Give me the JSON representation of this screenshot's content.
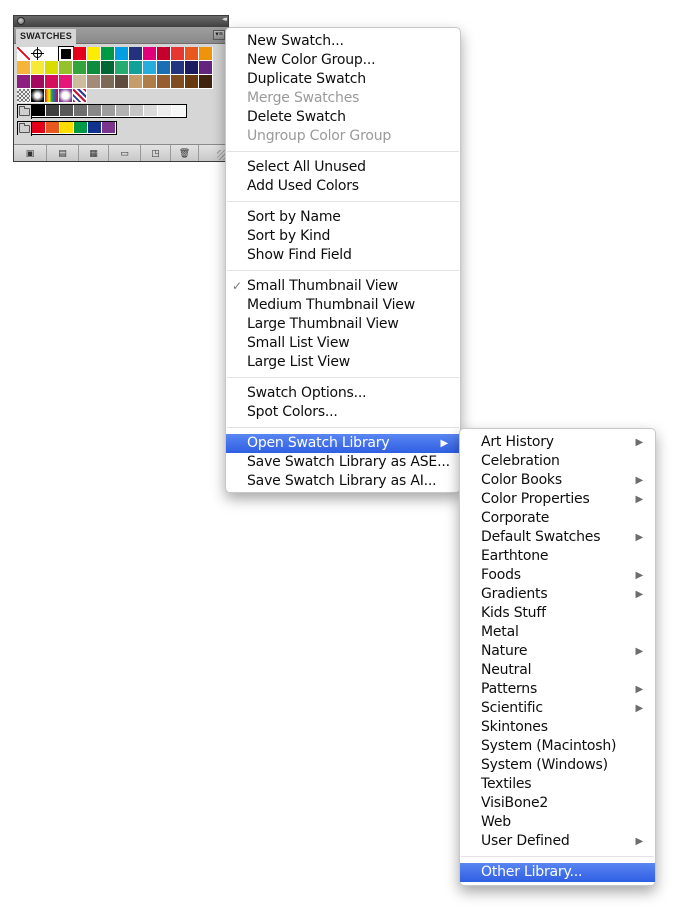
{
  "panel": {
    "tab_label": "SWATCHES",
    "collapse_glyph": "◂◂",
    "menu_glyph": "▾≡",
    "rows": [
      [
        "none",
        "registration",
        "#ffffff",
        "#000000",
        "#e4001b",
        "#ffec00",
        "#009a47",
        "#009fe3",
        "#23317f",
        "#e2007a",
        "#c4002f",
        "#e53631",
        "#e8581e",
        "#f0930c"
      ],
      [
        "#f6b43a",
        "#f7ea37",
        "#d8dc00",
        "#95c12b",
        "#33a43c",
        "#0c8d3e",
        "#006634",
        "#25ab6f",
        "#11a198",
        "#27acde",
        "#1a6fb4",
        "#23357e",
        "#1b1c60",
        "#64257f"
      ],
      [
        "#8e1d81",
        "#a4095f",
        "#d40f5b",
        "#e5177a",
        "#cdbb9d",
        "#a38a79",
        "#7c6956",
        "#5e4c3f",
        "#c69c6b",
        "#af7d47",
        "#965d31",
        "#804c22",
        "#67390f",
        "#40230f"
      ],
      [
        "pattern-checker",
        "gradient-radial-bw",
        "gradient-rainbow",
        "gradient-radial-purple",
        "pattern-plaid"
      ]
    ],
    "gray_group": [
      "#000000",
      "#3f3f3f",
      "#585858",
      "#6f6f6f",
      "#878787",
      "#9d9d9d",
      "#b2b2b2",
      "#c6c6c6",
      "#dadada",
      "#ececec",
      "#f5f6f6"
    ],
    "color_group": [
      "#e4001b",
      "#e8581e",
      "#ffdd00",
      "#009a47",
      "#10318e",
      "#7c338e"
    ],
    "bottom_icons": [
      {
        "name": "swatch-libraries-icon",
        "glyph": "▣"
      },
      {
        "name": "show-swatch-kinds-icon",
        "glyph": "▤"
      },
      {
        "name": "swatch-options-icon",
        "glyph": "▦"
      },
      {
        "name": "new-color-group-icon",
        "glyph": "▭"
      },
      {
        "name": "new-swatch-icon",
        "glyph": "◳"
      },
      {
        "name": "delete-swatch-icon",
        "glyph": "🗑"
      }
    ]
  },
  "main_menu": {
    "groups": [
      [
        {
          "label": "New Swatch...",
          "enabled": true
        },
        {
          "label": "New Color Group...",
          "enabled": true
        },
        {
          "label": "Duplicate Swatch",
          "enabled": true
        },
        {
          "label": "Merge Swatches",
          "enabled": false
        },
        {
          "label": "Delete Swatch",
          "enabled": true
        },
        {
          "label": "Ungroup Color Group",
          "enabled": false
        }
      ],
      [
        {
          "label": "Select All Unused",
          "enabled": true
        },
        {
          "label": "Add Used Colors",
          "enabled": true
        }
      ],
      [
        {
          "label": "Sort by Name",
          "enabled": true
        },
        {
          "label": "Sort by Kind",
          "enabled": true
        },
        {
          "label": "Show Find Field",
          "enabled": true
        }
      ],
      [
        {
          "label": "Small Thumbnail View",
          "enabled": true,
          "checked": true
        },
        {
          "label": "Medium Thumbnail View",
          "enabled": true
        },
        {
          "label": "Large Thumbnail View",
          "enabled": true
        },
        {
          "label": "Small List View",
          "enabled": true
        },
        {
          "label": "Large List View",
          "enabled": true
        }
      ],
      [
        {
          "label": "Swatch Options...",
          "enabled": true
        },
        {
          "label": "Spot Colors...",
          "enabled": true
        }
      ],
      [
        {
          "label": "Open Swatch Library",
          "enabled": true,
          "submenu": true,
          "highlighted": true
        },
        {
          "label": "Save Swatch Library as ASE...",
          "enabled": true
        },
        {
          "label": "Save Swatch Library as AI...",
          "enabled": true
        }
      ]
    ],
    "check_glyph": "✓",
    "arrow_glyph": "▶"
  },
  "sub_menu": {
    "groups": [
      [
        {
          "label": "Art History",
          "submenu": true
        },
        {
          "label": "Celebration"
        },
        {
          "label": "Color Books",
          "submenu": true
        },
        {
          "label": "Color Properties",
          "submenu": true
        },
        {
          "label": "Corporate"
        },
        {
          "label": "Default Swatches",
          "submenu": true
        },
        {
          "label": "Earthtone"
        },
        {
          "label": "Foods",
          "submenu": true
        },
        {
          "label": "Gradients",
          "submenu": true
        },
        {
          "label": "Kids Stuff"
        },
        {
          "label": "Metal"
        },
        {
          "label": "Nature",
          "submenu": true
        },
        {
          "label": "Neutral"
        },
        {
          "label": "Patterns",
          "submenu": true
        },
        {
          "label": "Scientific",
          "submenu": true
        },
        {
          "label": "Skintones"
        },
        {
          "label": "System (Macintosh)"
        },
        {
          "label": "System (Windows)"
        },
        {
          "label": "Textiles"
        },
        {
          "label": "VisiBone2"
        },
        {
          "label": "Web"
        },
        {
          "label": "User Defined",
          "submenu": true
        }
      ],
      [
        {
          "label": "Other Library...",
          "highlighted": true
        }
      ]
    ]
  },
  "colors": {
    "highlight": "#3a68e8",
    "disabled_text": "#9a9a9a",
    "panel_bg": "#d6d6d6"
  }
}
